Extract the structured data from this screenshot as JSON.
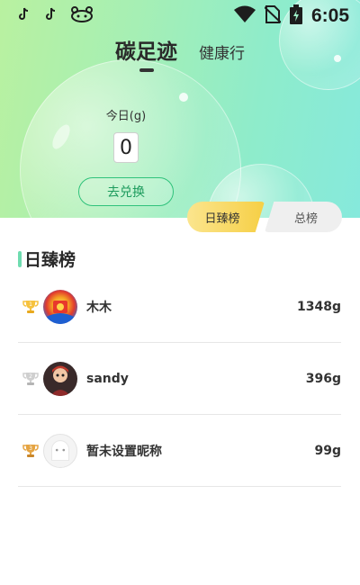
{
  "status_bar": {
    "time": "6:05",
    "left_icons": [
      "tiktok-icon",
      "tiktok-icon",
      "robot-face-icon"
    ],
    "right_icons": [
      "wifi-icon",
      "no-sim-icon",
      "battery-charging-icon"
    ]
  },
  "top_tabs": [
    {
      "label": "碳足迹",
      "active": true
    },
    {
      "label": "健康行",
      "active": false
    }
  ],
  "today": {
    "label": "今日(g)",
    "value": "0",
    "exchange_label": "去兑换"
  },
  "board_tabs": [
    {
      "label": "日臻榜",
      "active": true
    },
    {
      "label": "总榜",
      "active": false
    }
  ],
  "section_title": "日臻榜",
  "ranking": [
    {
      "rank": 1,
      "medal": "gold-trophy-icon",
      "avatar": "red-envelope-avatar",
      "name": "木木",
      "amount": "1348g"
    },
    {
      "rank": 2,
      "medal": "silver-trophy-icon",
      "avatar": "cartoon-character-avatar",
      "name": "sandy",
      "amount": "396g"
    },
    {
      "rank": 3,
      "medal": "bronze-trophy-icon",
      "avatar": "default-ghost-avatar",
      "name": "暂未设置昵称",
      "amount": "99g"
    }
  ],
  "colors": {
    "accent_green": "#2fc27b",
    "gold": "#f6cf45",
    "silver": "#c9c9c9",
    "bronze": "#e0a13c"
  }
}
